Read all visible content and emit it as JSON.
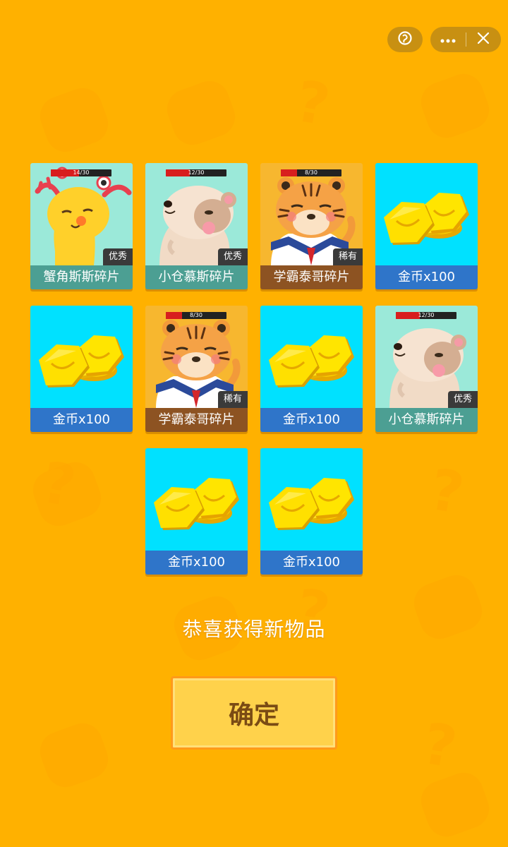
{
  "capsule": {
    "home_icon": "mini-program-icon",
    "more_icon": "more-icon",
    "close_icon": "close-icon"
  },
  "rewards": [
    {
      "type": "char",
      "theme": "mint",
      "name": "蟹角斯斯碎片",
      "rarity": "优秀",
      "progress_text": "14/30",
      "progress": 0.47,
      "art": "crab-deer-character"
    },
    {
      "type": "char",
      "theme": "mint",
      "name": "小仓慕斯碎片",
      "rarity": "优秀",
      "progress_text": "12/30",
      "progress": 0.4,
      "art": "hamster-character"
    },
    {
      "type": "char",
      "theme": "tiger",
      "name": "学霸泰哥碎片",
      "rarity": "稀有",
      "progress_text": "8/30",
      "progress": 0.27,
      "art": "tiger-character"
    },
    {
      "type": "coin",
      "name": "金币x100",
      "art": "gold-coins"
    },
    {
      "type": "coin",
      "name": "金币x100",
      "art": "gold-coins"
    },
    {
      "type": "char",
      "theme": "tiger",
      "name": "学霸泰哥碎片",
      "rarity": "稀有",
      "progress_text": "8/30",
      "progress": 0.27,
      "art": "tiger-character"
    },
    {
      "type": "coin",
      "name": "金币x100",
      "art": "gold-coins"
    },
    {
      "type": "char",
      "theme": "mint",
      "name": "小仓慕斯碎片",
      "rarity": "优秀",
      "progress_text": "12/30",
      "progress": 0.4,
      "art": "hamster-character"
    },
    {
      "type": "coin",
      "name": "金币x100",
      "art": "gold-coins"
    },
    {
      "type": "coin",
      "name": "金币x100",
      "art": "gold-coins"
    }
  ],
  "message": "恭喜获得新物品",
  "confirm_label": "确定",
  "colors": {
    "background": "#FFB100",
    "coin_bg": "#00E1FF",
    "coin_bar": "#2F75C9",
    "button": "#FFD24B"
  }
}
